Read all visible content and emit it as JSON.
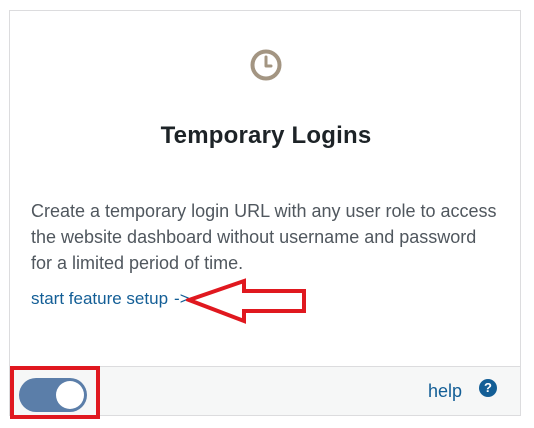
{
  "card": {
    "icon": "clock-icon",
    "title": "Temporary Logins",
    "description": "Create a temporary login URL with any user role to access the website dashboard without username and password for a limited period of time.",
    "setup_link_label": "start feature setup",
    "setup_link_arrow": "->"
  },
  "footer": {
    "toggle_enabled": true,
    "help_label": "help",
    "help_icon": "question-icon",
    "help_icon_glyph": "?"
  },
  "annotations": {
    "color": "#e0181f",
    "shapes": [
      "arrow-pointing-left-at-setup-link",
      "box-around-toggle"
    ]
  },
  "colors": {
    "link": "#135e96",
    "toggle_on": "#5b7ea9",
    "icon": "#a39582",
    "title": "#1d2327",
    "body_text": "#50575e"
  }
}
